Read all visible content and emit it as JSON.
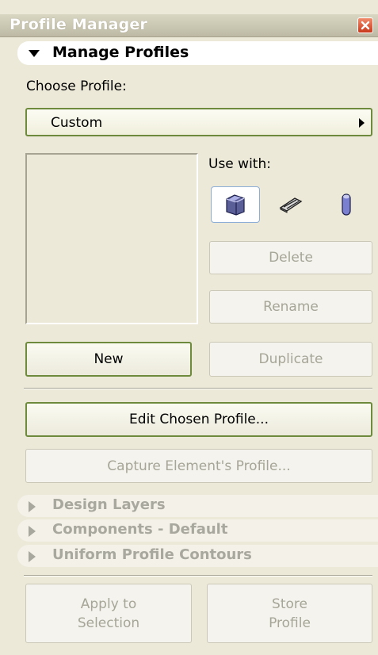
{
  "window": {
    "title": "Profile Manager"
  },
  "manage_profiles": {
    "header": "Manage Profiles",
    "choose_label": "Choose Profile:",
    "selected_profile": "Custom",
    "use_with_label": "Use with:",
    "tools": [
      {
        "name": "wall-tool",
        "selected": true
      },
      {
        "name": "beam-tool",
        "selected": false
      },
      {
        "name": "column-tool",
        "selected": false
      }
    ],
    "delete_label": "Delete",
    "rename_label": "Rename",
    "new_label": "New",
    "duplicate_label": "Duplicate",
    "edit_label": "Edit Chosen Profile...",
    "capture_label": "Capture Element's Profile..."
  },
  "collapsed_sections": [
    "Design Layers",
    "Components - Default",
    "Uniform Profile Contours"
  ],
  "footer": {
    "apply_line1": "Apply to",
    "apply_line2": "Selection",
    "store_line1": "Store",
    "store_line2": "Profile"
  },
  "colors": {
    "panel_bg": "#ece9d8",
    "enabled_border": "#6e8b3d",
    "disabled_text": "#a6a597",
    "close_button": "#c8391c"
  }
}
